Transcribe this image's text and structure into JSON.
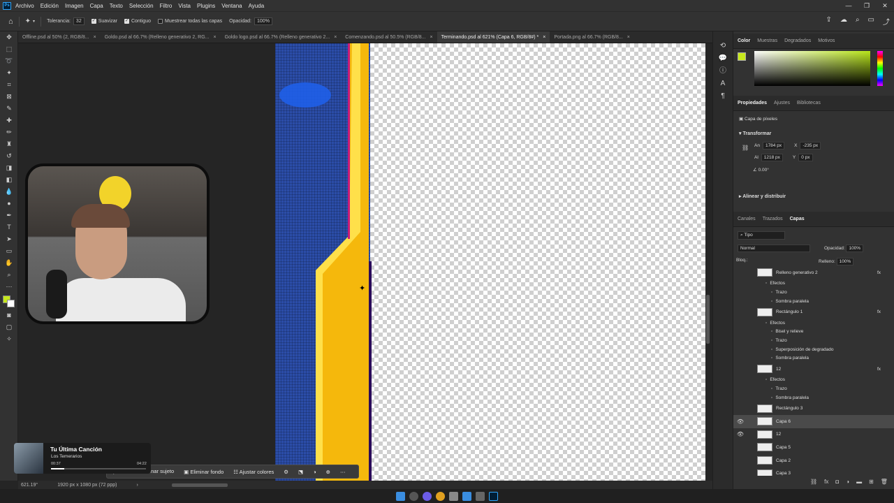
{
  "menubar": {
    "items": [
      "Archivo",
      "Edición",
      "Imagen",
      "Capa",
      "Texto",
      "Selección",
      "Filtro",
      "Vista",
      "Plugins",
      "Ventana",
      "Ayuda"
    ],
    "app_icon": "Ps"
  },
  "options": {
    "tolerance_label": "Tolerancia:",
    "tolerance_value": "32",
    "antialias_label": "Suavizar",
    "contiguous_label": "Contiguo",
    "sample_all_label": "Muestrear todas las capas",
    "opacity_label": "Opacidad:",
    "opacity_value": "100%"
  },
  "tabs": [
    {
      "label": "Offline.psd al 50% (2, RGB/8...",
      "close": "×"
    },
    {
      "label": "Goldo.psd al 66.7% (Relleno generativo 2, RG...",
      "close": "×"
    },
    {
      "label": "Goldo logo.psd al 66.7% (Relleno generativo 2...",
      "close": "×"
    },
    {
      "label": "Comenzando.psd al 50.5% (RGB/8...",
      "close": "×"
    },
    {
      "label": "Terminando.psd al 621% (Capa 6, RGB/8#) *",
      "close": "×"
    },
    {
      "label": "Portada.png al 66.7% (RGB/8...",
      "close": "×"
    }
  ],
  "contextbar": {
    "select_subject": "Seleccionar sujeto",
    "remove_bg": "Eliminar fondo",
    "adjust_colors": "Ajustar colores"
  },
  "status": {
    "zoom": "621.19°",
    "doc_size": "1920 px x 1080 px (72 ppp)"
  },
  "color_panel": {
    "tabs": [
      "Color",
      "Muestras",
      "Degradados",
      "Motivos"
    ],
    "fg": "#c6e81c",
    "bg": "#ffffff"
  },
  "properties": {
    "tabs": [
      "Propiedades",
      "Ajustes",
      "Bibliotecas"
    ],
    "kind": "Capa de píxeles",
    "transform_label": "Transformar",
    "w_label": "An",
    "w": "1784 px",
    "x_label": "X",
    "x": "-235 px",
    "h_label": "Al",
    "h": "1218 px",
    "y_label": "Y",
    "y": "0 px",
    "angle": "0.00°",
    "align_label": "Alinear y distribuir"
  },
  "layers_panel": {
    "tabs": [
      "Canales",
      "Trazados",
      "Capas"
    ],
    "filter": "Tipo",
    "blend": "Normal",
    "opacity_label": "Opacidad:",
    "opacity": "100%",
    "lock_label": "Bloq.:",
    "fill_label": "Relleno:",
    "fill": "100%",
    "rows": [
      {
        "name": "Relleno generativo 2",
        "type": "layer",
        "fx": true
      },
      {
        "name": "Efectos",
        "type": "fx-head"
      },
      {
        "name": "Trazo",
        "type": "fx"
      },
      {
        "name": "Sombra paralela",
        "type": "fx"
      },
      {
        "name": "Rectángulo 1",
        "type": "layer",
        "fx": true
      },
      {
        "name": "Efectos",
        "type": "fx-head"
      },
      {
        "name": "Bisel y relieve",
        "type": "fx"
      },
      {
        "name": "Trazo",
        "type": "fx"
      },
      {
        "name": "Superposición de degradado",
        "type": "fx"
      },
      {
        "name": "Sombra paralela",
        "type": "fx"
      },
      {
        "name": "12",
        "type": "layer",
        "fx": true
      },
      {
        "name": "Efectos",
        "type": "fx-head"
      },
      {
        "name": "Trazo",
        "type": "fx"
      },
      {
        "name": "Sombra paralela",
        "type": "fx"
      },
      {
        "name": "Rectángulo 3",
        "type": "layer"
      },
      {
        "name": "Capa 6",
        "type": "layer",
        "visible": true,
        "selected": true
      },
      {
        "name": "12",
        "type": "layer",
        "visible": true
      },
      {
        "name": "Capa 5",
        "type": "layer"
      },
      {
        "name": "Capa 2",
        "type": "layer"
      },
      {
        "name": "Capa 3",
        "type": "layer"
      }
    ]
  },
  "now_playing": {
    "title": "Tu Última Canción",
    "artist": "Los Temerarios",
    "elapsed": "00:37",
    "total": "04:22",
    "progress": 0.14
  }
}
